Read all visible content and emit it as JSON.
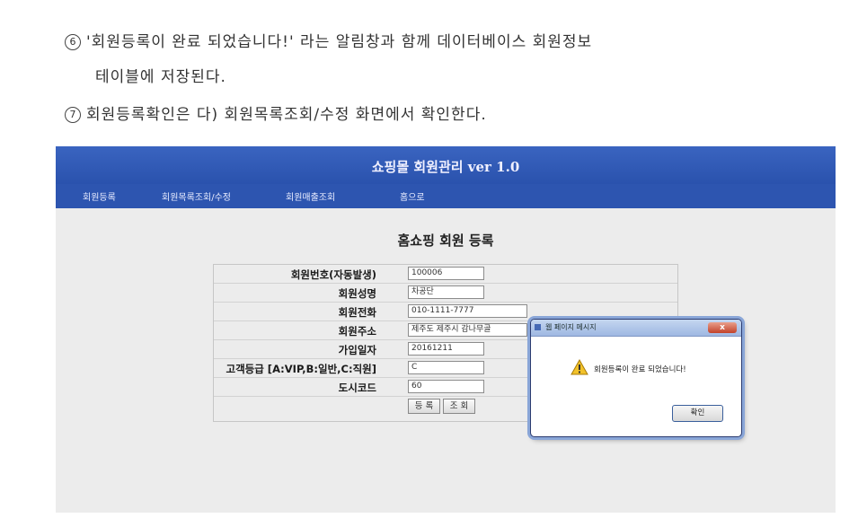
{
  "doc": {
    "step6_num": "6",
    "step6_line1": "'회원등록이 완료 되었습니다!' 라는 알림창과 함께 데이터베이스 회원정보",
    "step6_line2": "테이블에 저장된다.",
    "step7_num": "7",
    "step7_line": "회원등록확인은 다) 회원목록조회/수정 화면에서 확인한다."
  },
  "app": {
    "title": "쇼핑몰 회원관리 ver 1.0",
    "nav": [
      "회원등록",
      "회원목록조회/수정",
      "회원매출조회",
      "홈으로"
    ],
    "page_title": "홈쇼핑 회원 등록"
  },
  "form": {
    "rows": [
      {
        "label": "회원번호(자동발생)",
        "value": "100006"
      },
      {
        "label": "회원성명",
        "value": "차공단"
      },
      {
        "label": "회원전화",
        "value": "010-1111-7777"
      },
      {
        "label": "회원주소",
        "value": "제주도 제주시 감나무골"
      },
      {
        "label": "가입일자",
        "value": "20161211"
      },
      {
        "label": "고객등급 [A:VIP,B:일반,C:직원]",
        "value": "C"
      },
      {
        "label": "도시코드",
        "value": "60"
      }
    ],
    "register_label": "등 록",
    "lookup_label": "조 회"
  },
  "dialog": {
    "title": "웹 페이지 메시지",
    "message": "회원등록이 완료 되었습니다!",
    "ok_label": "확인",
    "close_label": "x"
  }
}
